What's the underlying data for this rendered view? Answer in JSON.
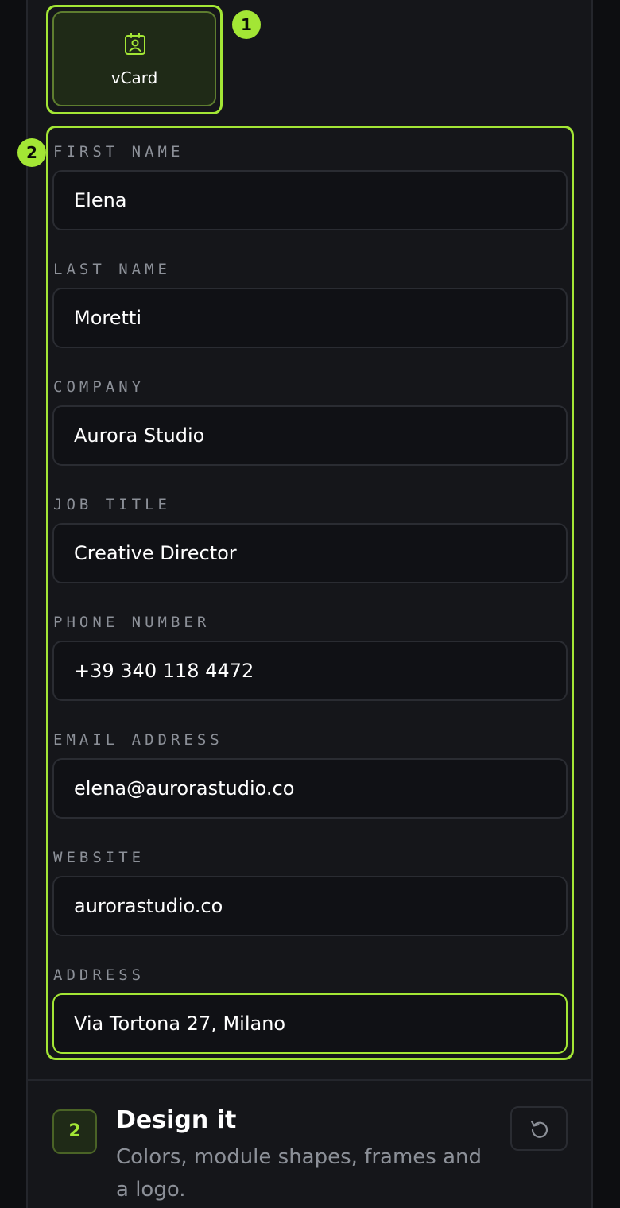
{
  "step1": {
    "vcard_button_label": "vCard",
    "callout_badge_1": "1",
    "callout_badge_2": "2"
  },
  "form": {
    "fields": [
      {
        "label": "FIRST NAME",
        "value": "Elena"
      },
      {
        "label": "LAST NAME",
        "value": "Moretti"
      },
      {
        "label": "COMPANY",
        "value": "Aurora Studio"
      },
      {
        "label": "JOB TITLE",
        "value": "Creative Director"
      },
      {
        "label": "PHONE NUMBER",
        "value": "+39 340 118 4472"
      },
      {
        "label": "EMAIL ADDRESS",
        "value": "elena@aurorastudio.co"
      },
      {
        "label": "WEBSITE",
        "value": "aurorastudio.co"
      },
      {
        "label": "ADDRESS",
        "value": "Via Tortona 27, Milano"
      }
    ],
    "active_field": "ADDRESS"
  },
  "step2": {
    "number": "2",
    "title": "Design it",
    "description": "Colors, module shapes, frames and a logo."
  },
  "icons": {
    "vcard": "contact-card-icon",
    "reset": "reset-icon"
  },
  "colors": {
    "accent": "#a3e635",
    "background": "#0d0e11",
    "panel": "#15161a",
    "label": "#8c9098"
  }
}
